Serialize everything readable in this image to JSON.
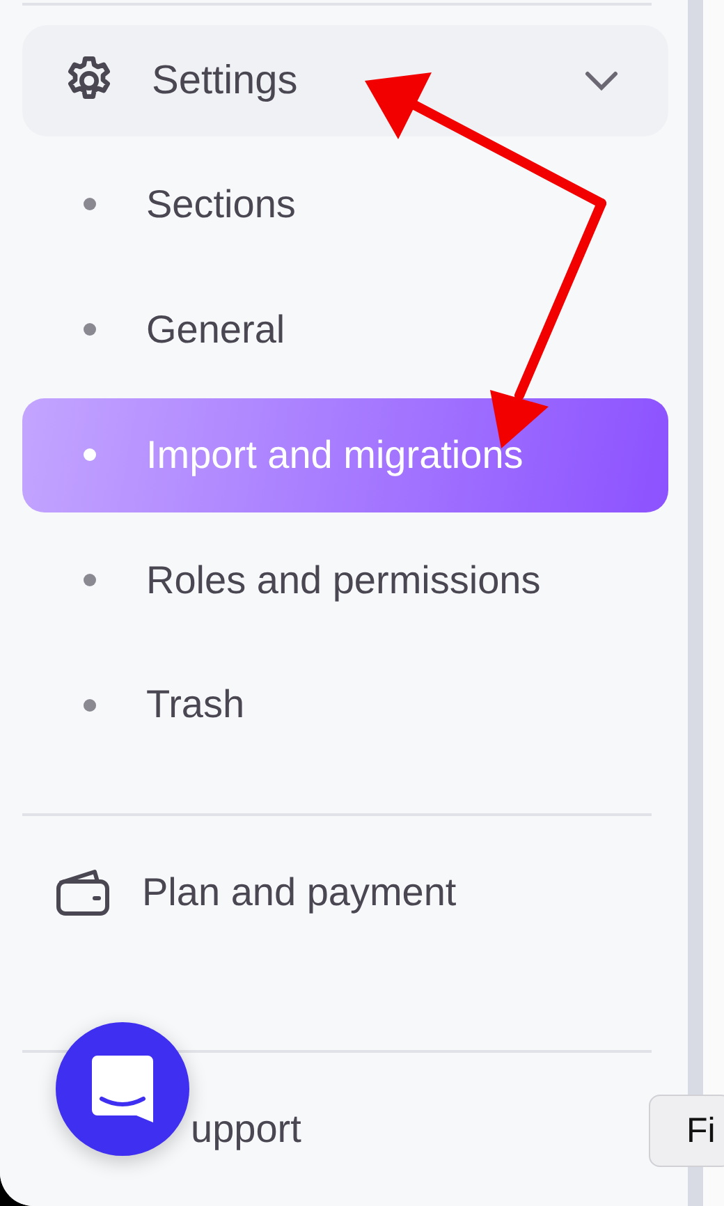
{
  "settings": {
    "label": "Settings",
    "expanded": true,
    "children": [
      {
        "label": "Sections",
        "selected": false
      },
      {
        "label": "General",
        "selected": false
      },
      {
        "label": "Import and migrations",
        "selected": true
      },
      {
        "label": "Roles and permissions",
        "selected": false
      },
      {
        "label": "Trash",
        "selected": false
      }
    ]
  },
  "plan": {
    "label": "Plan and payment"
  },
  "support": {
    "label": "upport"
  },
  "tooltip_button": {
    "label": "Fi"
  }
}
